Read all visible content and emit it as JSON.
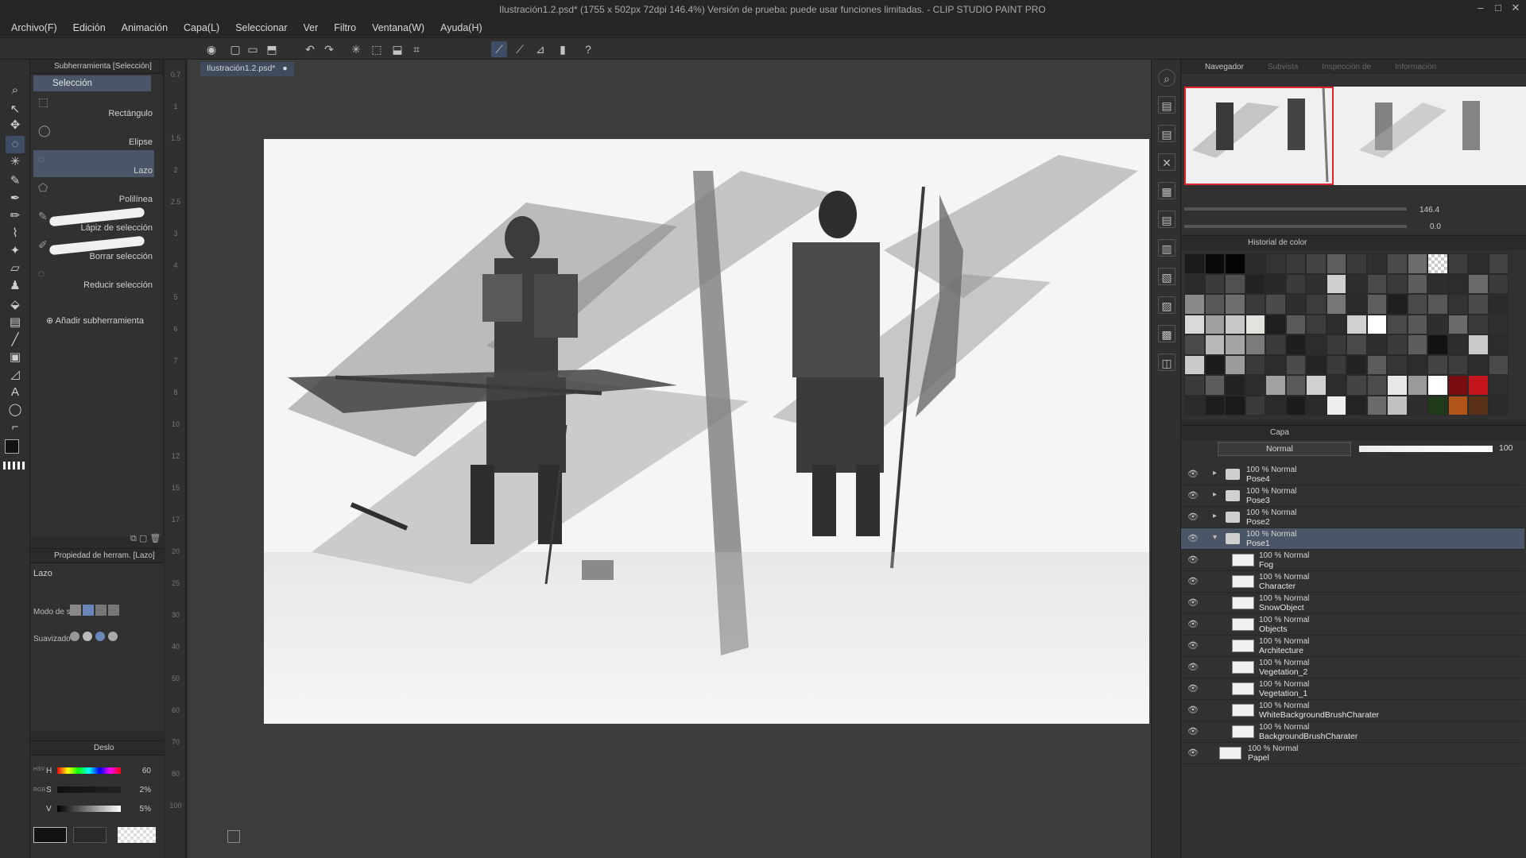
{
  "window": {
    "title": "Ilustración1.2.psd* (1755 x 502px 72dpi 146.4%)  Versión de prueba: puede usar funciones limitadas. - CLIP STUDIO PAINT PRO",
    "controls": [
      "–",
      "□",
      "✕"
    ]
  },
  "menu": [
    "Archivo(F)",
    "Edición",
    "Animación",
    "Capa(L)",
    "Seleccionar",
    "Ver",
    "Filtro",
    "Ventana(W)",
    "Ayuda(H)"
  ],
  "subtool_panel": {
    "header": "Subherramienta [Selección]",
    "group": "Selección",
    "items": [
      {
        "label": "Rectángulo",
        "icon": "rect-select-icon"
      },
      {
        "label": "Elipse",
        "icon": "ellipse-select-icon"
      },
      {
        "label": "Lazo",
        "icon": "lasso-icon"
      },
      {
        "label": "Polilínea",
        "icon": "polyline-icon"
      },
      {
        "label": "Lápiz de selección",
        "icon": "selection-pen-icon"
      },
      {
        "label": "Borrar selección",
        "icon": "erase-selection-icon"
      },
      {
        "label": "Reducir selección",
        "icon": "shrink-selection-icon"
      }
    ],
    "add_label": "Añadir subherramienta"
  },
  "ruler_numbers": [
    "0.7",
    "1",
    "1.5",
    "2",
    "2.5",
    "3",
    "4",
    "5",
    "6",
    "7",
    "8",
    "10",
    "12",
    "15",
    "17",
    "20",
    "25",
    "30",
    "40",
    "50",
    "60",
    "70",
    "80",
    "100"
  ],
  "tool_property": {
    "header": "Propiedad de herram. [Lazo]",
    "title": "Lazo",
    "rows": [
      "Modo de s.",
      "Suavizado"
    ]
  },
  "color_panel": {
    "tab": "Deslo",
    "h": {
      "label": "H",
      "value": "60"
    },
    "s": {
      "label": "S",
      "value": "2%"
    },
    "v": {
      "label": "V",
      "value": "5%"
    },
    "mode_labels": [
      "HSV",
      "RGB"
    ]
  },
  "document_tab": "Ilustración1.2.psd*",
  "navigator": {
    "tabs": [
      "Navegador",
      "Subvista",
      "Inspección de",
      "Información"
    ],
    "zoom": "146.4",
    "rotation": "0.0"
  },
  "color_history": {
    "header": "Historial de color",
    "swatches": [
      "#1b1b1b",
      "#0a0a0a",
      "#050505",
      "#2a2a2a",
      "#333333",
      "#3a3a3a",
      "#444444",
      "#5e5e5e",
      "#3b3b3b",
      "#2f2f2f",
      "#4b4b4b",
      "#6c6c6c",
      "checker",
      "#3c3c3c",
      "#2e2e2e",
      "#444444",
      "#2a2a2a",
      "#3b3b3b",
      "#505050",
      "#222222",
      "#292929",
      "#3b3b3b",
      "#303030",
      "#cfcfcf",
      "#2d2d2d",
      "#4a4a4a",
      "#3a3a3a",
      "#5c5c5c",
      "#2e2e2e",
      "#2c2c2c",
      "#6a6a6a",
      "#3b3b3b",
      "#8a8a8a",
      "#585858",
      "#6e6e6e",
      "#3a3a3a",
      "#4b4b4b",
      "#2e2e2e",
      "#3c3c3c",
      "#767676",
      "#2a2a2a",
      "#5e5e5e",
      "#1f1f1f",
      "#494949",
      "#575757",
      "#333333",
      "#4a4a4a",
      "#2b2b2b",
      "#d9d9d9",
      "#9f9f9f",
      "#c8c8c8",
      "#e3e3dd",
      "#1f1f1f",
      "#5a5a5a",
      "#3c3c3c",
      "#2d2d2d",
      "#d1d1d1",
      "#ffffff",
      "#4a4a4a",
      "#585858",
      "#2e2e2e",
      "#6a6a6a",
      "#3b3b3b",
      "#2f2f2f",
      "#4a4a4a",
      "#b8b8b8",
      "#a5a5a5",
      "#7b7b7b",
      "#3b3b3b",
      "#1e1e1e",
      "#2c2c2c",
      "#3a3a3a",
      "#4a4a4a",
      "#2e2e2e",
      "#3b3b3b",
      "#5d5d5d",
      "#121212",
      "#2d2d2d",
      "#c9c9c9",
      "#2c2c2c",
      "#cbcbcb",
      "#1b1b1b",
      "#9c9c9c",
      "#3a3a3a",
      "#2c2c2c",
      "#4b4b4b",
      "#242424",
      "#3b3b3b",
      "#222222",
      "#5b5b5b",
      "#363636",
      "#2c2c2c",
      "#444444",
      "#3d3d3d",
      "#2d2d2d",
      "#4a4a4a",
      "#3b3b3b",
      "#5c5c5c",
      "#222222",
      "#2c2c2c",
      "#a1a1a1",
      "#5a5a5a",
      "#d0d0d0",
      "#2c2c2c",
      "#444444",
      "#4c4c4c",
      "#e8e8e8",
      "#9a9a9a",
      "#ffffff",
      "#7a0b0f",
      "#c4141c",
      "#2f2f2f",
      "#2b2b2b",
      "#1e1e1e",
      "#1a1a1a",
      "#3b3b3b",
      "#2a2a2a",
      "#1c1c1c",
      "#2b2b2b",
      "#efefef",
      "#232323",
      "#6a6a6a",
      "#c2c2c2",
      "#2d2d2d",
      "#203a1b",
      "#b0541a",
      "#5a3017",
      "#2b2b2b"
    ]
  },
  "layers": {
    "header": "Capa",
    "blend_mode": "Normal",
    "opacity": "100",
    "rows": [
      {
        "mode": "100 % Normal",
        "name": "Pose4",
        "type": "folder",
        "selected": false,
        "indent": 0
      },
      {
        "mode": "100 % Normal",
        "name": "Pose3",
        "type": "folder",
        "selected": false,
        "indent": 0
      },
      {
        "mode": "100 % Normal",
        "name": "Pose2",
        "type": "folder",
        "selected": false,
        "indent": 0
      },
      {
        "mode": "100 % Normal",
        "name": "Pose1",
        "type": "folder",
        "selected": true,
        "indent": 0
      },
      {
        "mode": "100 % Normal",
        "name": "Fog",
        "type": "raster",
        "selected": false,
        "indent": 1
      },
      {
        "mode": "100 % Normal",
        "name": "Character",
        "type": "raster",
        "selected": false,
        "indent": 1
      },
      {
        "mode": "100 % Normal",
        "name": "SnowObject",
        "type": "raster",
        "selected": false,
        "indent": 1
      },
      {
        "mode": "100 % Normal",
        "name": "Objects",
        "type": "raster",
        "selected": false,
        "indent": 1
      },
      {
        "mode": "100 % Normal",
        "name": "Architecture",
        "type": "raster",
        "selected": false,
        "indent": 1
      },
      {
        "mode": "100 % Normal",
        "name": "Vegetation_2",
        "type": "raster",
        "selected": false,
        "indent": 1
      },
      {
        "mode": "100 % Normal",
        "name": "Vegetation_1",
        "type": "raster",
        "selected": false,
        "indent": 1
      },
      {
        "mode": "100 % Normal",
        "name": "WhiteBackgroundBrushCharater",
        "type": "raster",
        "selected": false,
        "indent": 1
      },
      {
        "mode": "100 % Normal",
        "name": "BackgroundBrushCharater",
        "type": "raster",
        "selected": false,
        "indent": 1
      },
      {
        "mode": "100 % Normal",
        "name": "Papel",
        "type": "paper",
        "selected": false,
        "indent": 0
      }
    ]
  }
}
